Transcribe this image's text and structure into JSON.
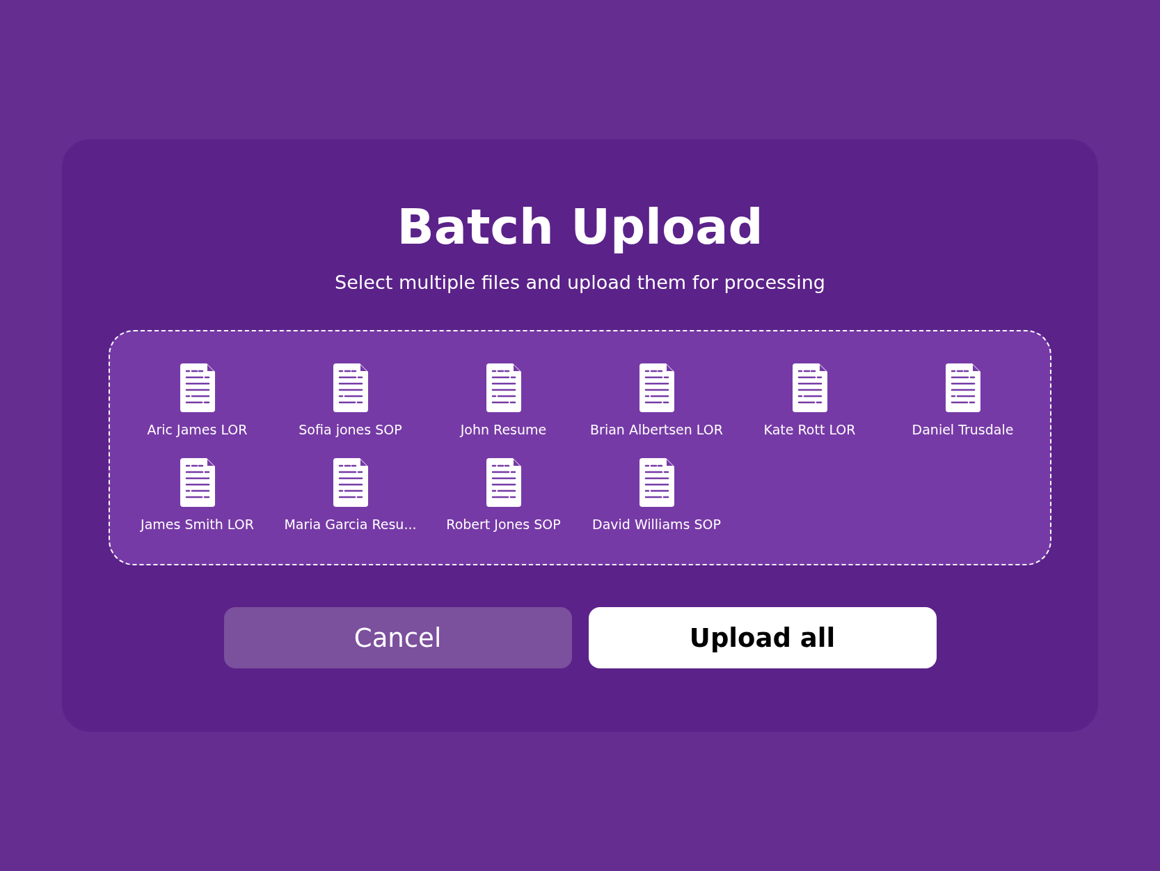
{
  "dialog": {
    "title": "Batch Upload",
    "subtitle": "Select multiple files and upload them for processing",
    "files": [
      {
        "name": "Aric James LOR"
      },
      {
        "name": "Sofia jones SOP"
      },
      {
        "name": "John Resume"
      },
      {
        "name": "Brian Albertsen LOR"
      },
      {
        "name": "Kate Rott LOR"
      },
      {
        "name": "Daniel Trusdale"
      },
      {
        "name": "James Smith LOR"
      },
      {
        "name": "Maria Garcia Resu..."
      },
      {
        "name": "Robert Jones SOP"
      },
      {
        "name": "David Williams SOP"
      }
    ],
    "buttons": [
      {
        "label": "Cancel",
        "kind": "secondary"
      },
      {
        "label": "Upload all",
        "kind": "primary"
      }
    ]
  }
}
